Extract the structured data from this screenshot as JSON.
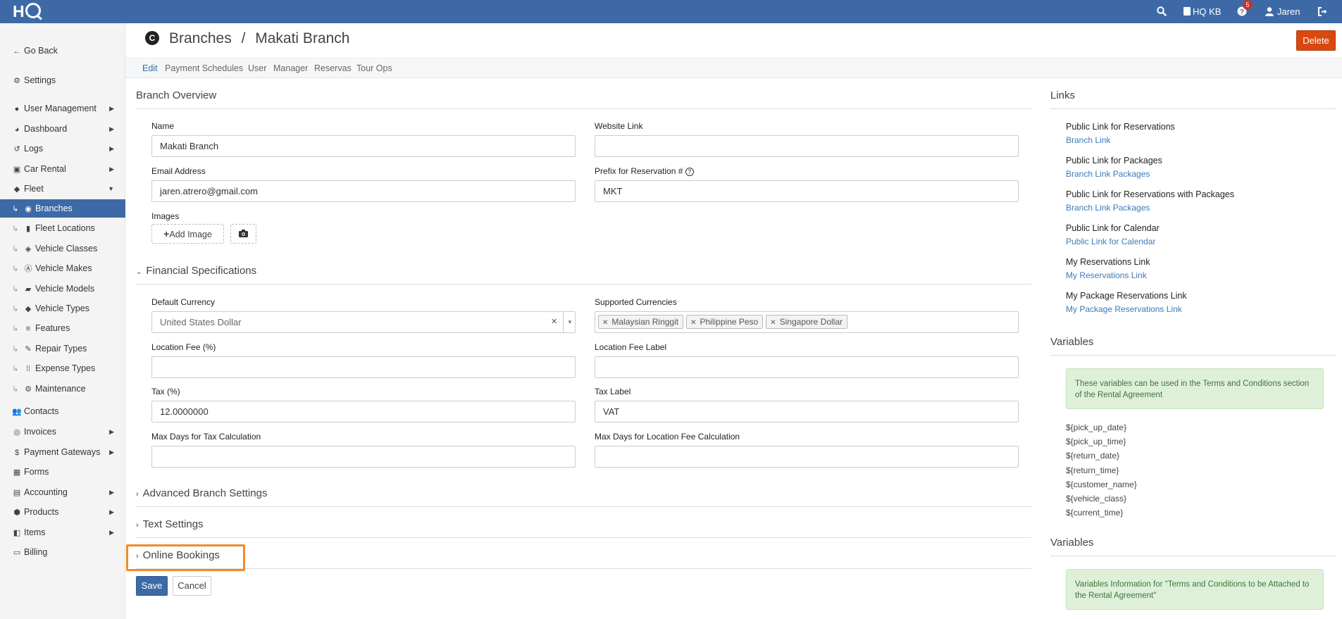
{
  "topbar": {
    "logo": "HQ",
    "kb": "HQ KB",
    "help_badge": "5",
    "user": "Jaren"
  },
  "sidebar": {
    "go_back": "Go Back",
    "settings": "Settings",
    "items": [
      {
        "label": "User Management",
        "icon": "user-icon",
        "caret": true
      },
      {
        "label": "Dashboard",
        "icon": "pie-chart-icon",
        "caret": true
      },
      {
        "label": "Logs",
        "icon": "history-icon",
        "caret": true
      },
      {
        "label": "Car Rental",
        "icon": "calendar-check-icon",
        "caret": true
      },
      {
        "label": "Fleet",
        "icon": "car-icon",
        "caret": "down"
      }
    ],
    "fleet_sub": [
      {
        "label": "Branches",
        "icon": "branch-c-icon",
        "active": true
      },
      {
        "label": "Fleet Locations",
        "icon": "building-icon"
      },
      {
        "label": "Vehicle Classes",
        "icon": "tags-icon"
      },
      {
        "label": "Vehicle Makes",
        "icon": "letter-a-icon"
      },
      {
        "label": "Vehicle Models",
        "icon": "truck-icon"
      },
      {
        "label": "Vehicle Types",
        "icon": "tag-icon"
      },
      {
        "label": "Features",
        "icon": "database-icon"
      },
      {
        "label": "Repair Types",
        "icon": "wrench-icon"
      },
      {
        "label": "Expense Types",
        "icon": "dots-grid-icon"
      },
      {
        "label": "Maintenance",
        "icon": "gear-icon"
      }
    ],
    "bottom": [
      {
        "label": "Contacts",
        "icon": "users-icon",
        "caret": false
      },
      {
        "label": "Invoices",
        "icon": "coins-icon",
        "caret": true
      },
      {
        "label": "Payment Gateways",
        "icon": "dollar-icon",
        "caret": true
      },
      {
        "label": "Forms",
        "icon": "table-icon",
        "caret": false
      },
      {
        "label": "Accounting",
        "icon": "book-icon",
        "caret": true
      },
      {
        "label": "Products",
        "icon": "box-icon",
        "caret": true
      },
      {
        "label": "Items",
        "icon": "layers-icon",
        "caret": true
      },
      {
        "label": "Billing",
        "icon": "credit-card-icon",
        "caret": false
      }
    ]
  },
  "header": {
    "breadcrumb_root": "Branches",
    "separator": "/",
    "breadcrumb_current": "Makati Branch",
    "delete_label": "Delete"
  },
  "tabs": [
    "Edit",
    "Payment Schedules",
    "User",
    "Manager",
    "Reservas",
    "Tour Ops"
  ],
  "branch_overview": {
    "title": "Branch Overview",
    "name_label": "Name",
    "name_value": "Makati Branch",
    "website_label": "Website Link",
    "website_value": "",
    "email_label": "Email Address",
    "email_value": "jaren.atrero@gmail.com",
    "prefix_label": "Prefix for Reservation #",
    "prefix_value": "MKT",
    "images_label": "Images",
    "add_image_label": "Add Image"
  },
  "financial": {
    "title": "Financial Specifications",
    "default_currency_label": "Default Currency",
    "default_currency_value": "United States Dollar",
    "supported_currencies_label": "Supported Currencies",
    "supported_currencies": [
      "Malaysian Ringgit",
      "Philippine Peso",
      "Singapore Dollar"
    ],
    "location_fee_label": "Location Fee (%)",
    "location_fee_value": "",
    "location_fee_label_label": "Location Fee Label",
    "location_fee_label_value": "",
    "tax_label": "Tax (%)",
    "tax_value": "12.0000000",
    "tax_label_label": "Tax Label",
    "tax_label_value": "VAT",
    "max_days_tax_label": "Max Days for Tax Calculation",
    "max_days_tax_value": "",
    "max_days_location_label": "Max Days for Location Fee Calculation",
    "max_days_location_value": ""
  },
  "collapsed_sections": [
    "Advanced Branch Settings",
    "Text Settings",
    "Online Bookings"
  ],
  "actions": {
    "save": "Save",
    "cancel": "Cancel"
  },
  "links_panel": {
    "title": "Links",
    "items": [
      {
        "label": "Public Link for Reservations",
        "link": "Branch Link"
      },
      {
        "label": "Public Link for Packages",
        "link": "Branch Link Packages"
      },
      {
        "label": "Public Link for Reservations with Packages",
        "link": "Branch Link Packages"
      },
      {
        "label": "Public Link for Calendar",
        "link": "Public Link for Calendar"
      },
      {
        "label": "My Reservations Link",
        "link": "My Reservations Link"
      },
      {
        "label": "My Package Reservations Link",
        "link": "My Package Reservations Link"
      }
    ]
  },
  "variables_panel": {
    "title": "Variables",
    "alert": "These variables can be used in the Terms and Conditions section of the Rental Agreement",
    "vars": [
      "${pick_up_date}",
      "${pick_up_time}",
      "${return_date}",
      "${return_time}",
      "${customer_name}",
      "${vehicle_class}",
      "${current_time}"
    ]
  },
  "variables_panel_2": {
    "title": "Variables",
    "alert": "Variables Information for \"Terms and Conditions to be Attached to the Rental Agreement\""
  },
  "colors": {
    "brand": "#3d6aa6",
    "delete": "#d9480f",
    "highlight": "#f28a2c",
    "link": "#3d7ab8",
    "alert_bg": "#dff0d8"
  }
}
